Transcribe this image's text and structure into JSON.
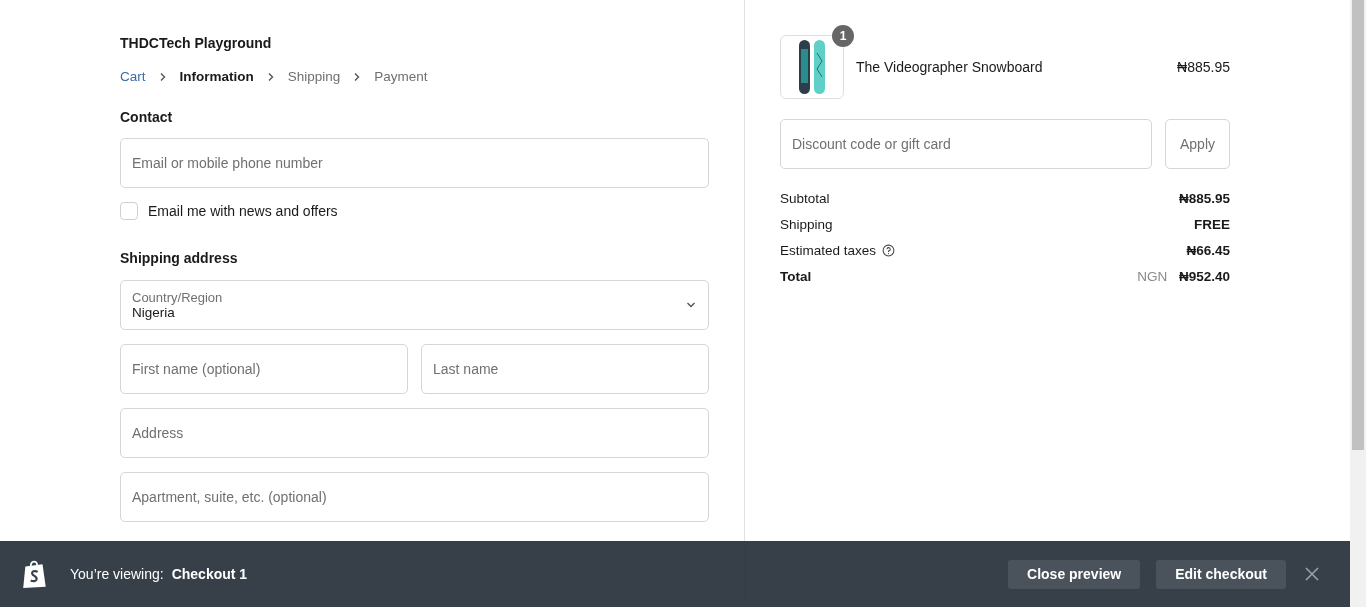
{
  "store_name": "THDCTech Playground",
  "breadcrumbs": [
    {
      "label": "Cart",
      "kind": "link"
    },
    {
      "label": "Information",
      "kind": "current"
    },
    {
      "label": "Shipping",
      "kind": "upcoming"
    },
    {
      "label": "Payment",
      "kind": "upcoming"
    }
  ],
  "contact": {
    "heading": "Contact",
    "email_field": {
      "placeholder": "Email or mobile phone number"
    },
    "newsletter": {
      "label": "Email me with news and offers",
      "checked": false
    }
  },
  "shipping_address": {
    "heading": "Shipping address",
    "rows": [
      [
        {
          "kind": "select",
          "label": "Country/Region",
          "value": "Nigeria"
        }
      ],
      [
        {
          "kind": "text",
          "placeholder": "First name (optional)"
        },
        {
          "kind": "text",
          "placeholder": "Last name"
        }
      ],
      [
        {
          "kind": "text",
          "placeholder": "Address"
        }
      ],
      [
        {
          "kind": "text",
          "placeholder": "Apartment, suite, etc. (optional)"
        }
      ]
    ]
  },
  "order": {
    "items": [
      {
        "name": "The Videographer Snowboard",
        "quantity": "1",
        "price": "₦885.95"
      }
    ],
    "discount": {
      "placeholder": "Discount code or gift card",
      "button": "Apply"
    },
    "summary": [
      {
        "kind": "line",
        "label": "Subtotal",
        "value": "₦885.95",
        "info": false
      },
      {
        "kind": "line",
        "label": "Shipping",
        "value": "FREE",
        "info": false
      },
      {
        "kind": "line",
        "label": "Estimated taxes",
        "value": "₦66.45",
        "info": true
      },
      {
        "kind": "total",
        "label": "Total",
        "currency": "NGN",
        "value": "₦952.40",
        "info": false
      }
    ]
  },
  "preview_bar": {
    "prefix": "You’re viewing:",
    "name": "Checkout 1",
    "buttons": [
      "Close preview",
      "Edit checkout"
    ]
  }
}
